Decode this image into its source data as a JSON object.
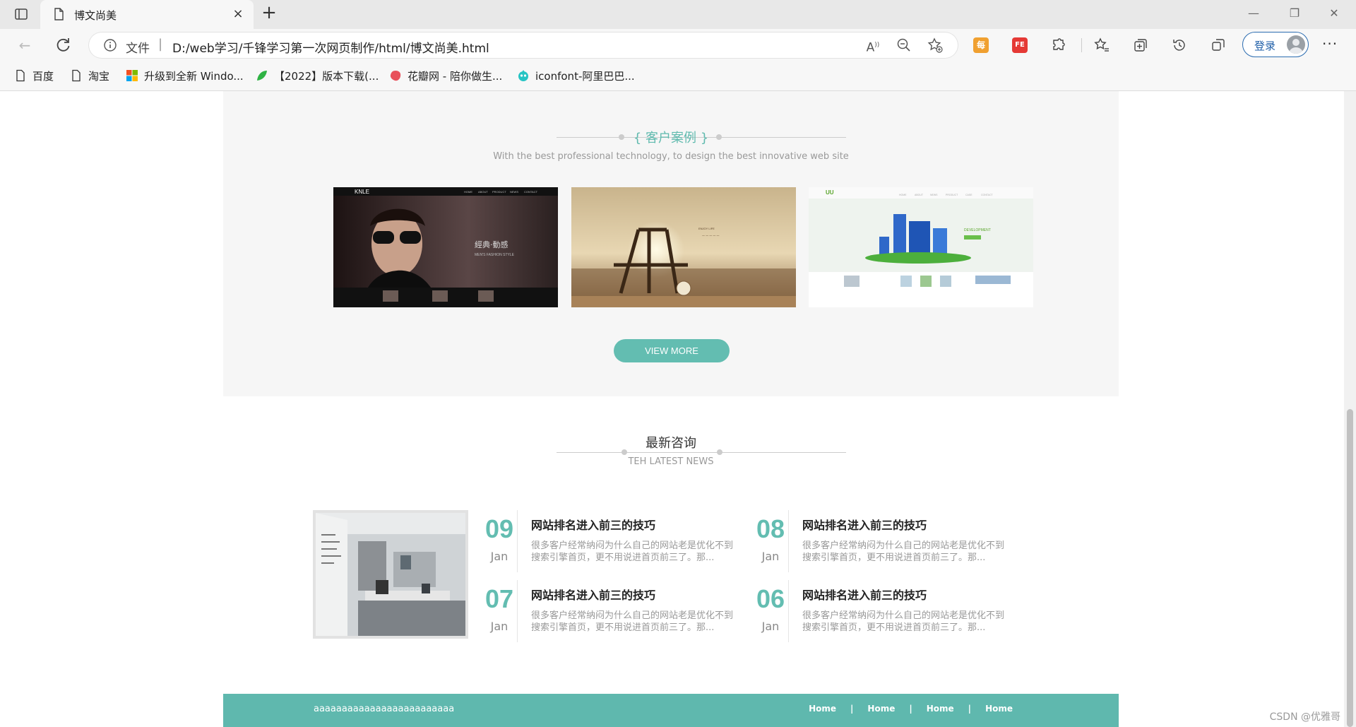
{
  "browser": {
    "tab_title": "博文尚美",
    "address_file_label": "文件",
    "address_url": "D:/web学习/千锋学习第一次网页制作/html/博文尚美.html",
    "login_label": "登录",
    "more_label": "···",
    "new_tab_label": "+",
    "close_label": "×",
    "ext_labels": [
      "每",
      "FE"
    ]
  },
  "bookmarks": [
    {
      "label": "百度",
      "icon": "file-icon"
    },
    {
      "label": "淘宝",
      "icon": "file-icon"
    },
    {
      "label": "升级到全新 Windo...",
      "icon": "windows-icon"
    },
    {
      "label": "【2022】版本下载(...",
      "icon": "leaf-icon"
    },
    {
      "label": "花瓣网 - 陪你做生...",
      "icon": "huaban-icon"
    },
    {
      "label": "iconfont-阿里巴巴...",
      "icon": "iconfont-icon"
    }
  ],
  "cases": {
    "heading": "{ 客户案例 }",
    "subheading": "With the best professional technology, to design the best innovative web site",
    "button": "VIEW MORE"
  },
  "news": {
    "heading": "最新咨询",
    "subheading": "TEH LATEST NEWS",
    "items": [
      {
        "day": "09",
        "month": "Jan",
        "title": "网站排名进入前三的技巧",
        "desc": "很多客户经常纳闷为什么自己的网站老是优化不到搜索引擎首页，更不用说进首页前三了。那..."
      },
      {
        "day": "08",
        "month": "Jan",
        "title": "网站排名进入前三的技巧",
        "desc": "很多客户经常纳闷为什么自己的网站老是优化不到搜索引擎首页，更不用说进首页前三了。那..."
      },
      {
        "day": "07",
        "month": "Jan",
        "title": "网站排名进入前三的技巧",
        "desc": "很多客户经常纳闷为什么自己的网站老是优化不到搜索引擎首页，更不用说进首页前三了。那..."
      },
      {
        "day": "06",
        "month": "Jan",
        "title": "网站排名进入前三的技巧",
        "desc": "很多客户经常纳闷为什么自己的网站老是优化不到搜索引擎首页，更不用说进首页前三了。那..."
      }
    ]
  },
  "footer": {
    "text": "aaaaaaaaaaaaaaaaaaaaaaaaa",
    "links": [
      "Home",
      "Home",
      "Home",
      "Home"
    ]
  },
  "watermark": "CSDN @优雅哥",
  "colors": {
    "accent": "#63bdb1",
    "footer": "#5fb8ae"
  }
}
